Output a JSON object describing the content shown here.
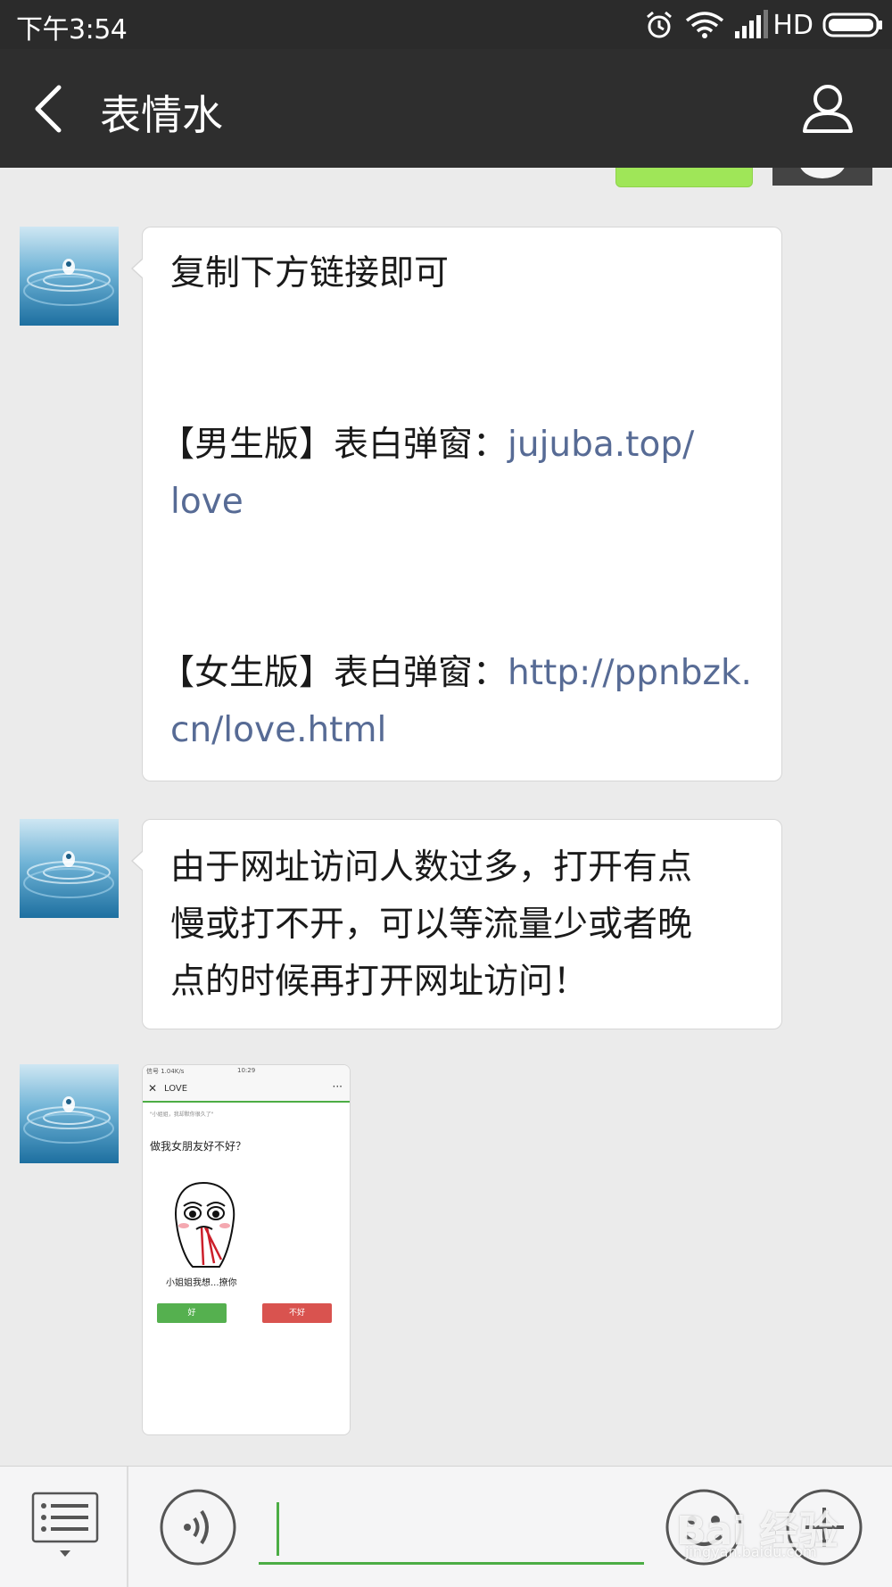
{
  "status_bar": {
    "time": "下午3:54",
    "network_label": "HD",
    "icons": [
      "alarm-icon",
      "wifi-icon",
      "signal-icon",
      "battery-icon"
    ]
  },
  "nav": {
    "title": "表情水",
    "back_icon": "chevron-left-icon",
    "profile_icon": "person-icon"
  },
  "messages": [
    {
      "lines": [
        {
          "text": "复制下方链接即可"
        },
        {
          "text": ""
        },
        {
          "prefix": "【男生版】表白弹窗：",
          "link": "jujuba.top/"
        },
        {
          "link": "love"
        },
        {
          "text": ""
        },
        {
          "prefix": "【女生版】表白弹窗：",
          "link": "http://ppnbzk."
        },
        {
          "link": "cn/love.html"
        }
      ]
    },
    {
      "lines": [
        "由于网址访问人数过多，打开有点",
        "慢或打不开，可以等流量少或者晚",
        "点的时候再打开网址访问！"
      ]
    }
  ],
  "image_message": {
    "status_left": "信号 1.04K/s",
    "status_time": "10:29",
    "close": "✕",
    "title": "LOVE",
    "more": "···",
    "subtitle": "\"小姐姐，我却默你很久了\"",
    "question": "做我女朋友好不好？",
    "caption": "小姐姐我想...撩你",
    "yes_label": "好",
    "no_label": "不好"
  },
  "input_bar": {
    "menu_icon": "list-menu-icon",
    "voice_icon": "voice-icon",
    "emoji_icon": "emoji-icon",
    "plus_icon": "plus-icon",
    "placeholder": ""
  },
  "watermark": {
    "brand": "Bai 经验",
    "url": "jingyan.baidu.com"
  },
  "colors": {
    "nav_bg": "#2e2e2e",
    "chat_bg": "#ebebeb",
    "link": "#576b95",
    "accent_green": "#4cad45",
    "sent_bubble": "#9fe658"
  }
}
